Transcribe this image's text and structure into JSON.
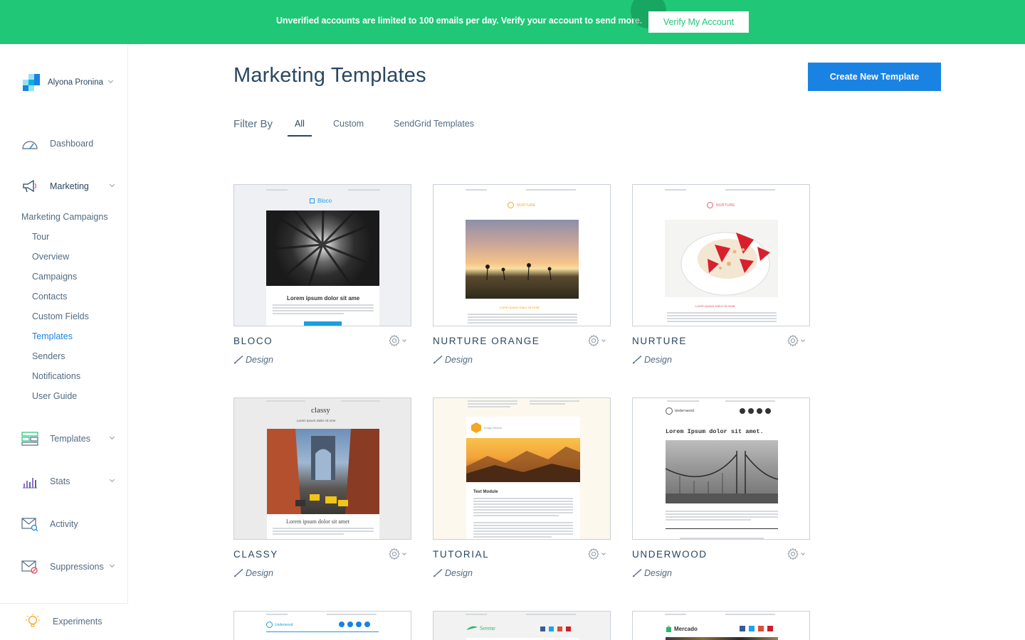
{
  "banner": {
    "message": "Unverified accounts are limited to 100 emails per day. Verify your account to send more.",
    "button_label": "Verify My Account",
    "bg_color": "#1fc777"
  },
  "account": {
    "name": "Alyona Pronina"
  },
  "nav": {
    "dashboard": "Dashboard",
    "marketing": "Marketing",
    "marketing_campaigns": "Marketing Campaigns",
    "sub_items": [
      "Tour",
      "Overview",
      "Campaigns",
      "Contacts",
      "Custom Fields",
      "Templates",
      "Senders",
      "Notifications",
      "User Guide"
    ],
    "templates": "Templates",
    "stats": "Stats",
    "activity": "Activity",
    "suppressions": "Suppressions",
    "experiments": "Experiments"
  },
  "page": {
    "title": "Marketing Templates",
    "create_button": "Create New Template",
    "accent_color": "#1a82e2"
  },
  "filter": {
    "label": "Filter By",
    "tabs": [
      "All",
      "Custom",
      "SendGrid Templates"
    ],
    "active": "All"
  },
  "templates": [
    {
      "name": "BLOCO",
      "action": "Design",
      "thumb_logo": "Bloco",
      "thumb_caption": "Lorem ipsum dolor sit ame"
    },
    {
      "name": "NURTURE ORANGE",
      "action": "Design",
      "thumb_logo": "NURTURE",
      "thumb_caption": "Lorem Ipsum Dolor sit Amet"
    },
    {
      "name": "NURTURE",
      "action": "Design",
      "thumb_logo": "NURTURE",
      "thumb_caption": "Lorem Ipsum Dolor sit Amet"
    },
    {
      "name": "CLASSY",
      "action": "Design",
      "thumb_logo": "classy",
      "thumb_sub": "Lorem Ipsum Dolor sit Ame",
      "thumb_caption": "Lorem ipsum dolor sit amet"
    },
    {
      "name": "TUTORIAL",
      "action": "Design",
      "thumb_logo": "Image Module",
      "thumb_caption": "Text Module"
    },
    {
      "name": "UNDERWOOD",
      "action": "Design",
      "thumb_logo": "Underwood",
      "thumb_caption": "Lorem Ipsum dolor sit amet."
    }
  ],
  "partial_templates": [
    {
      "thumb_logo": "Underwood"
    },
    {
      "thumb_logo": "Serene"
    },
    {
      "thumb_logo": "Mercado"
    }
  ]
}
